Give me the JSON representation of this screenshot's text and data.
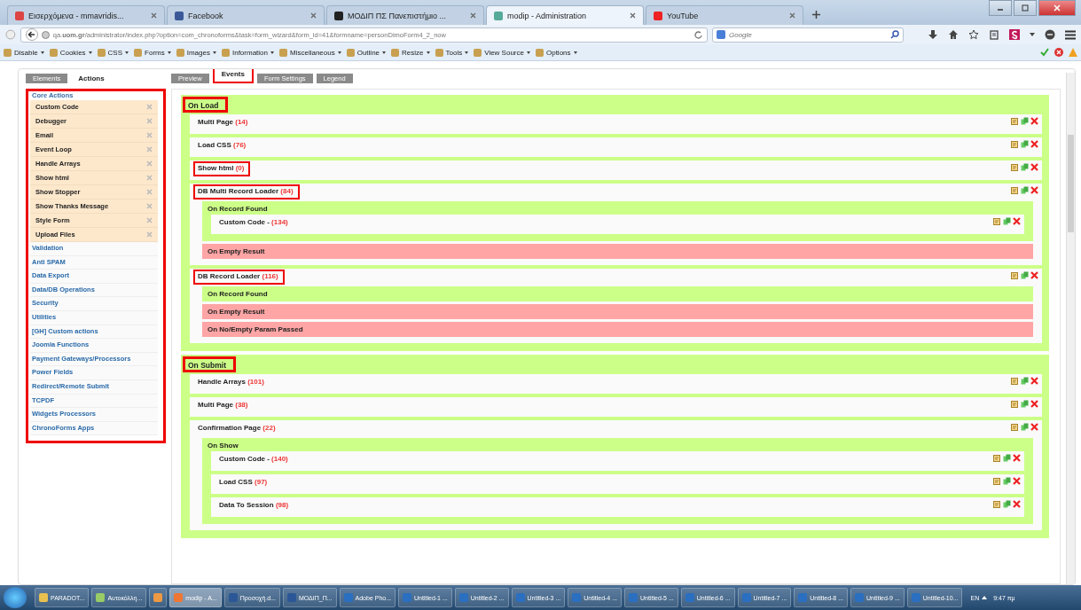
{
  "browser": {
    "tabs": [
      {
        "title": "Εισερχόμενα - mmavridis...",
        "selected": false
      },
      {
        "title": "Facebook",
        "selected": false
      },
      {
        "title": "ΜΟΔΙΠ ΠΣ Πανεπιστήμιο ...",
        "selected": false
      },
      {
        "title": "modip - Administration",
        "selected": true
      },
      {
        "title": "YouTube",
        "selected": false
      }
    ],
    "url": "qa.**uom.gr**/administrator/index.php?option=com_chronoforms&task=form_wizard&form_id=41&formname=personDimoForm4_2_now",
    "search_placeholder": "Google",
    "toolbar": [
      "Disable",
      "Cookies",
      "CSS",
      "Forms",
      "Images",
      "Information",
      "Miscellaneous",
      "Outline",
      "Resize",
      "Tools",
      "View Source",
      "Options"
    ]
  },
  "sidebar": {
    "tabs": [
      {
        "label": "Elements",
        "selected": false
      },
      {
        "label": "Actions",
        "selected": true
      }
    ],
    "highlighted": true,
    "group_title": "Core Actions",
    "core_actions": [
      "Custom Code",
      "Debugger",
      "Email",
      "Event Loop",
      "Handle Arrays",
      "Show html",
      "Show Stopper",
      "Show Thanks Message",
      "Style Form",
      "Upload Files"
    ],
    "categories": [
      "Validation",
      "Anti SPAM",
      "Data Export",
      "Data/DB Operations",
      "Security",
      "Utilities",
      "[GH] Custom actions",
      "Joomla Functions",
      "Payment Gateways/Processors",
      "Power Fields",
      "Redirect/Remote Submit",
      "TCPDF",
      "Widgets Processors",
      "ChronoForms Apps"
    ]
  },
  "editor": {
    "tabs": [
      {
        "label": "Preview",
        "selected": false,
        "highlighted": false
      },
      {
        "label": "Events",
        "selected": true,
        "highlighted": true
      },
      {
        "label": "Form Settings",
        "selected": false,
        "highlighted": false
      },
      {
        "label": "Legend",
        "selected": false,
        "highlighted": false
      }
    ],
    "events": [
      {
        "title": "On Load",
        "highlighted": true,
        "actions": [
          {
            "name": "Multi Page",
            "count": "(14)",
            "highlighted": false
          },
          {
            "name": "Load CSS",
            "count": "(76)",
            "highlighted": false
          },
          {
            "name": "Show html",
            "count": "(0)",
            "highlighted": true
          },
          {
            "name": "DB Multi Record Loader",
            "count": "(84)",
            "highlighted": true,
            "events": [
              {
                "title": "On Record Found",
                "kind": "success",
                "actions": [
                  {
                    "name": "Custom Code -",
                    "count": "(134)",
                    "highlighted": false
                  }
                ]
              },
              {
                "title": "On Empty Result",
                "kind": "failure"
              }
            ]
          },
          {
            "name": "DB Record Loader",
            "count": "(116)",
            "highlighted": true,
            "events": [
              {
                "title": "On Record Found",
                "kind": "success"
              },
              {
                "title": "On Empty Result",
                "kind": "failure"
              },
              {
                "title": "On No/Empty Param Passed",
                "kind": "failure"
              }
            ]
          }
        ]
      },
      {
        "title": "On Submit",
        "highlighted": true,
        "actions": [
          {
            "name": "Handle Arrays",
            "count": "(101)",
            "highlighted": false
          },
          {
            "name": "Multi Page",
            "count": "(38)",
            "highlighted": false
          },
          {
            "name": "Confirmation Page",
            "count": "(22)",
            "highlighted": false,
            "events": [
              {
                "title": "On Show",
                "kind": "success",
                "actions": [
                  {
                    "name": "Custom Code -",
                    "count": "(140)",
                    "highlighted": false
                  },
                  {
                    "name": "Load CSS",
                    "count": "(97)",
                    "highlighted": false
                  },
                  {
                    "name": "Data To Session",
                    "count": "(98)",
                    "highlighted": false
                  }
                ]
              }
            ]
          }
        ]
      }
    ]
  },
  "taskbar": {
    "items": [
      {
        "label": "PARADOT...",
        "selected": false
      },
      {
        "label": "Αυτοκόλλη...",
        "selected": false
      },
      {
        "selected": false
      },
      {
        "label": "modip - A...",
        "selected": true
      },
      {
        "label": "Προσοχή.d...",
        "selected": false
      },
      {
        "label": "ΜΟΔΙΠ_Π...",
        "selected": false
      },
      {
        "label": "Adobe Pho...",
        "selected": false
      },
      {
        "label": "Untitled-1 ...",
        "selected": false
      },
      {
        "label": "Untitled-2 ...",
        "selected": false
      },
      {
        "label": "Untitled-3 ...",
        "selected": false
      },
      {
        "label": "Untitled-4 ...",
        "selected": false
      },
      {
        "label": "Untitled-5 ...",
        "selected": false
      },
      {
        "label": "Untitled-6 ...",
        "selected": false
      },
      {
        "label": "Untitled-7 ...",
        "selected": false
      },
      {
        "label": "Untitled-8 ...",
        "selected": false
      },
      {
        "label": "Untitled-9 ...",
        "selected": false
      },
      {
        "label": "Untitled-10...",
        "selected": false
      }
    ],
    "language": "EN",
    "clock": "9:47 πμ"
  }
}
